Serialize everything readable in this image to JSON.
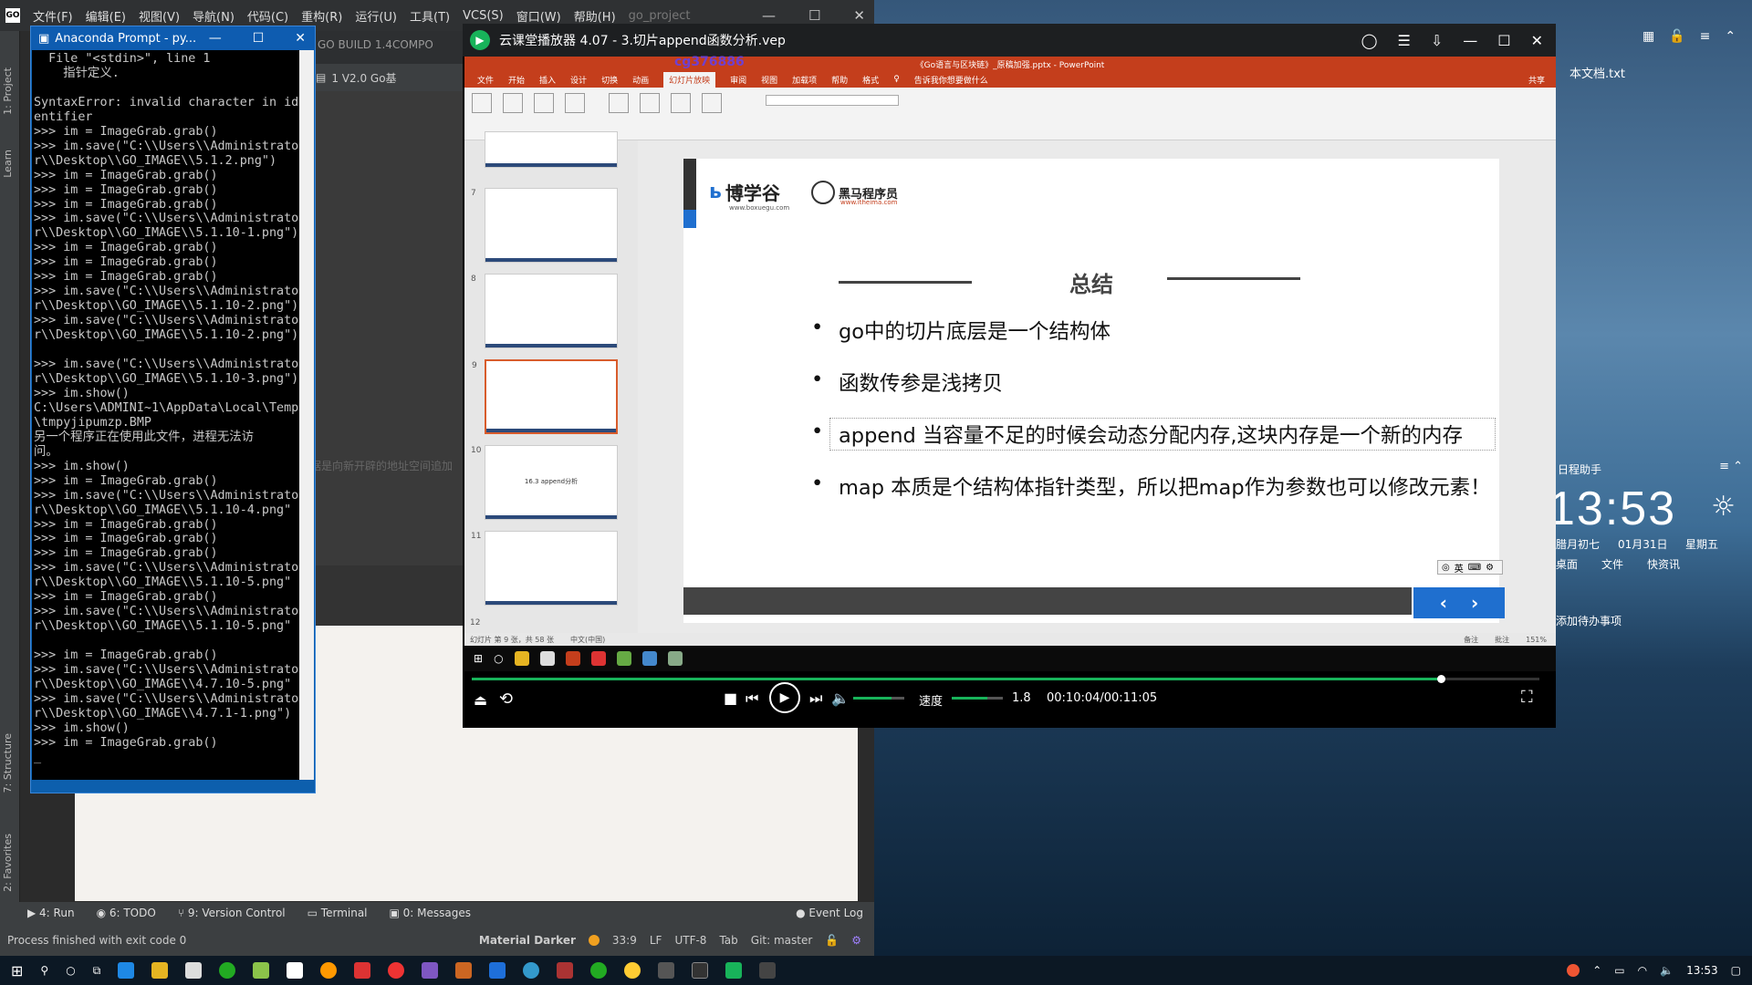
{
  "ide": {
    "menu": [
      "文件(F)",
      "编辑(E)",
      "视图(V)",
      "导航(N)",
      "代码(C)",
      "重构(R)",
      "运行(U)",
      "工具(T)",
      "VCS(S)",
      "窗口(W)",
      "帮助(H)"
    ],
    "project_name": "go_project",
    "tab_build": "GO BUILD 1.4COMPO",
    "tab_file": "1 V2.0 Go基",
    "side_project": "1: Project",
    "side_learn": "Learn",
    "side_structure": "7: Structure",
    "side_favorites": "2: Favorites",
    "editor_snippet": "据是向新开辟的地址空间追加",
    "toolwindows": [
      "4: Run",
      "6: TODO",
      "9: Version Control",
      "Terminal",
      "0: Messages"
    ],
    "event_log": "Event Log",
    "status_text": "Process finished with exit code 0",
    "status_theme": "Material Darker",
    "status_pos": "33:9",
    "status_le": "LF",
    "status_enc": "UTF-8",
    "status_indent": "Tab",
    "status_git": "Git: master"
  },
  "conda": {
    "title": "Anaconda Prompt - py...",
    "lines": [
      "  File \"<stdin>\", line 1",
      "    指针定义.",
      "",
      "SyntaxError: invalid character in id",
      "entifier",
      ">>> im = ImageGrab.grab()",
      ">>> im.save(\"C:\\\\Users\\\\Administrato",
      "r\\\\Desktop\\\\GO_IMAGE\\\\5.1.2.png\")",
      ">>> im = ImageGrab.grab()",
      ">>> im = ImageGrab.grab()",
      ">>> im = ImageGrab.grab()",
      ">>> im.save(\"C:\\\\Users\\\\Administrato",
      "r\\\\Desktop\\\\GO_IMAGE\\\\5.1.10-1.png\")",
      ">>> im = ImageGrab.grab()",
      ">>> im = ImageGrab.grab()",
      ">>> im = ImageGrab.grab()",
      ">>> im.save(\"C:\\\\Users\\\\Administrato",
      "r\\\\Desktop\\\\GO_IMAGE\\\\5.1.10-2.png\")",
      ">>> im.save(\"C:\\\\Users\\\\Administrato",
      "r\\\\Desktop\\\\GO_IMAGE\\\\5.1.10-2.png\")",
      "",
      ">>> im.save(\"C:\\\\Users\\\\Administrato",
      "r\\\\Desktop\\\\GO_IMAGE\\\\5.1.10-3.png\")",
      ">>> im.show()",
      "C:\\Users\\ADMINI~1\\AppData\\Local\\Temp",
      "\\tmpyjipumzp.BMP",
      "另一个程序正在使用此文件，进程无法访",
      "问。",
      ">>> im.show()",
      ">>> im = ImageGrab.grab()",
      ">>> im.save(\"C:\\\\Users\\\\Administrato",
      "r\\\\Desktop\\\\GO_IMAGE\\\\5.1.10-4.png\"",
      ">>> im = ImageGrab.grab()",
      ">>> im = ImageGrab.grab()",
      ">>> im = ImageGrab.grab()",
      ">>> im.save(\"C:\\\\Users\\\\Administrato",
      "r\\\\Desktop\\\\GO_IMAGE\\\\5.1.10-5.png\"",
      ">>> im = ImageGrab.grab()",
      ">>> im.save(\"C:\\\\Users\\\\Administrato",
      "r\\\\Desktop\\\\GO_IMAGE\\\\5.1.10-5.png\"",
      "",
      ">>> im = ImageGrab.grab()",
      ">>> im.save(\"C:\\\\Users\\\\Administrato",
      "r\\\\Desktop\\\\GO_IMAGE\\\\4.7.10-5.png\"",
      ">>> im.save(\"C:\\\\Users\\\\Administrato",
      "r\\\\Desktop\\\\GO_IMAGE\\\\4.7.1-1.png\")",
      ">>> im.show()",
      ">>> im = ImageGrab.grab()",
      "_"
    ]
  },
  "player": {
    "title": "云课堂播放器 4.07 - 3.切片append函数分析.vep",
    "watermark": "cg376886",
    "speed_label": "速度",
    "speed_value": "1.8",
    "time": "00:10:04/00:11:05",
    "progress_fraction": 0.908,
    "volume_fraction": 0.75,
    "speed_fraction": 0.7
  },
  "ppt": {
    "window_title": "《Go语言与区块链》_原稿加强.pptx - PowerPoint",
    "tabs": [
      "文件",
      "开始",
      "插入",
      "设计",
      "切换",
      "动画",
      "幻灯片放映",
      "审阅",
      "视图",
      "加载项",
      "帮助",
      "格式"
    ],
    "active_tab": "幻灯片放映",
    "tell_me": "告诉我你想要做什么",
    "share": "共享",
    "slide_counter": "幻灯片 第 9 张，共 58 张",
    "language": "中文(中国)",
    "notes": "备注",
    "comments": "批注",
    "zoom": "151%",
    "thumb_numbers": [
      "7",
      "8",
      "9",
      "10",
      "11",
      "12"
    ],
    "thumb10_text": "16.3 append分析"
  },
  "slide": {
    "brand1": "博学谷",
    "brand1_sub": "www.boxuegu.com",
    "brand2": "黑马程序员",
    "brand2_sub": "www.itheima.com",
    "title": "总结",
    "bullets": [
      "go中的切片底层是一个结构体",
      " 函数传参是浅拷贝",
      "append 当容量不足的时候会动态分配内存,这块内存是一个新的内存",
      "map 本质是个结构体指针类型，所以把map作为参数也可以修改元素！"
    ],
    "nav_prev": "‹",
    "nav_next": "›",
    "ime_text": "英"
  },
  "desktop": {
    "file_label": "本文档.txt",
    "assistant_title": "日程助手",
    "clock": "13:53",
    "lunar": "腊月初七",
    "date": "01月31日",
    "weekday": "星期五",
    "links": [
      "桌面",
      "文件",
      "快资讯"
    ],
    "todo": "添加待办事项"
  },
  "taskbar": {
    "time": "13:53"
  },
  "colors": {
    "ppt_accent": "#c43e1c",
    "player_green": "#18b35a",
    "conda_blue": "#0e5cb0",
    "nav_blue": "#1f6fcf"
  }
}
